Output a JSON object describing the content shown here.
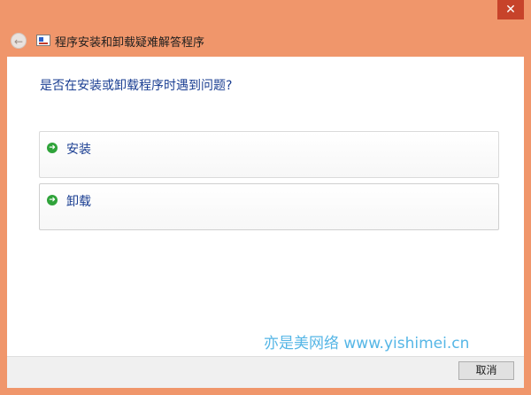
{
  "window": {
    "title": "程序安装和卸载疑难解答程序",
    "close_glyph": "✕",
    "back_glyph": "←"
  },
  "main": {
    "question": "是否在安装或卸载程序时遇到问题?",
    "options": [
      {
        "label": "安装",
        "icon": "green-arrow-icon"
      },
      {
        "label": "卸载",
        "icon": "green-arrow-icon"
      }
    ],
    "arrow_glyph": "➜"
  },
  "watermark": "亦是美网络 www.yishimei.cn",
  "footer": {
    "cancel_label": "取消"
  },
  "colors": {
    "frame": "#f0966b",
    "close_button": "#c7432a",
    "link_text": "#1a3e92",
    "watermark": "#55b6e6",
    "arrow": "#2fa33a"
  }
}
